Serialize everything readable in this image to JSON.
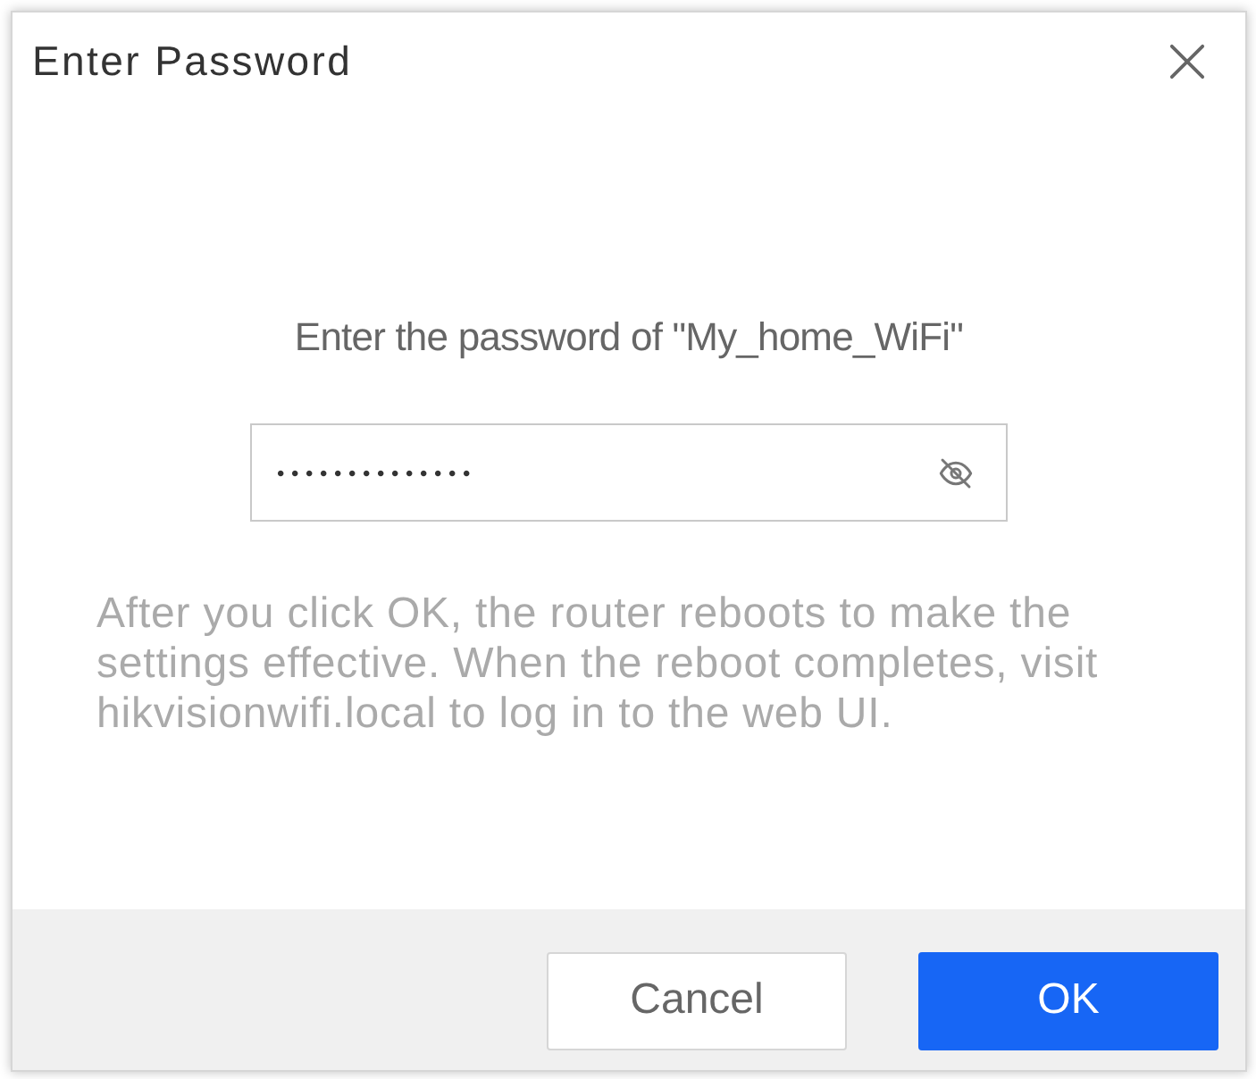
{
  "dialog": {
    "title": "Enter Password",
    "prompt": "Enter the password of \"My_home_WiFi\"",
    "password_field": {
      "value": "••••••••••••••"
    },
    "note": "After you click OK, the router reboots to make the settings effective. When the reboot completes, visit hikvisionwifi.local to log in to the web UI.",
    "buttons": [
      {
        "label": "Cancel",
        "kind": "secondary"
      },
      {
        "label": "OK",
        "kind": "primary"
      }
    ]
  }
}
